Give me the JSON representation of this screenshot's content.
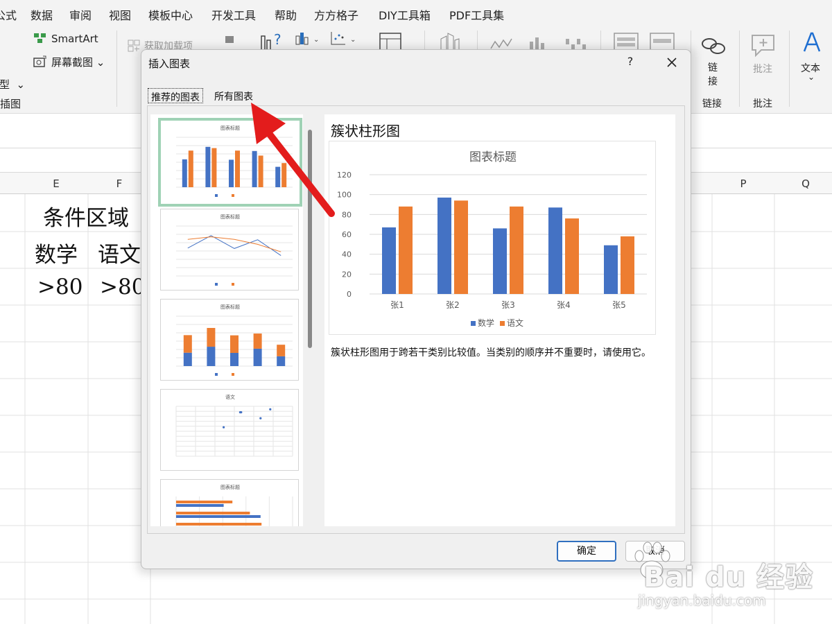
{
  "menubar": {
    "items": [
      "公式",
      "数据",
      "审阅",
      "视图",
      "模板中心",
      "开发工具",
      "帮助",
      "方方格子",
      "DIY工具箱",
      "PDF工具集"
    ]
  },
  "ribbon": {
    "smartart_label": "SmartArt",
    "screenshot_label": "屏幕截图",
    "model_label": "模型",
    "illustrations_group": "插图",
    "get_addins_label": "获取加载项",
    "link_label": "链接",
    "link_group": "链接",
    "comment_label": "批注",
    "comment_group": "批注",
    "text_label": "文本"
  },
  "sheet": {
    "columns": [
      "E",
      "F",
      "P",
      "Q"
    ],
    "cells": {
      "condition_area": "条件区域",
      "math": "数学",
      "chinese": "语文",
      "math_cond": ">80",
      "chinese_cond": ">80"
    }
  },
  "dialog": {
    "title": "插入图表",
    "help": "?",
    "tabs": [
      "推荐的图表",
      "所有图表"
    ],
    "preview_title": "簇状柱形图",
    "description": "簇状柱形图用于跨若干类别比较值。当类别的顺序并不重要时，请使用它。",
    "ok_label": "确定",
    "cancel_label": "取消",
    "thumbnails": [
      {
        "title": "图表标题",
        "type": "clustered-column"
      },
      {
        "title": "图表标题",
        "type": "line"
      },
      {
        "title": "图表标题",
        "type": "stacked-column"
      },
      {
        "title": "语文",
        "type": "scatter"
      },
      {
        "title": "图表标题",
        "type": "clustered-bar"
      }
    ]
  },
  "chart_data": {
    "type": "bar",
    "title": "图表标题",
    "categories": [
      "张1",
      "张2",
      "张3",
      "张4",
      "张5"
    ],
    "series": [
      {
        "name": "数学",
        "values": [
          67,
          97,
          66,
          87,
          49
        ],
        "color": "#4472c4"
      },
      {
        "name": "语文",
        "values": [
          88,
          94,
          88,
          76,
          58
        ],
        "color": "#ed7d31"
      }
    ],
    "ylim": [
      0,
      120
    ],
    "yticks": [
      0,
      20,
      40,
      60,
      80,
      100,
      120
    ],
    "grid": true,
    "legend": "bottom"
  },
  "watermark": {
    "logo": "Bai du 经验",
    "url": "jingyan.baidu.com"
  },
  "colors": {
    "accent": "#2f6fbf",
    "selected_thumb": "#9fd2b5",
    "arrow": "#e31c1c"
  }
}
